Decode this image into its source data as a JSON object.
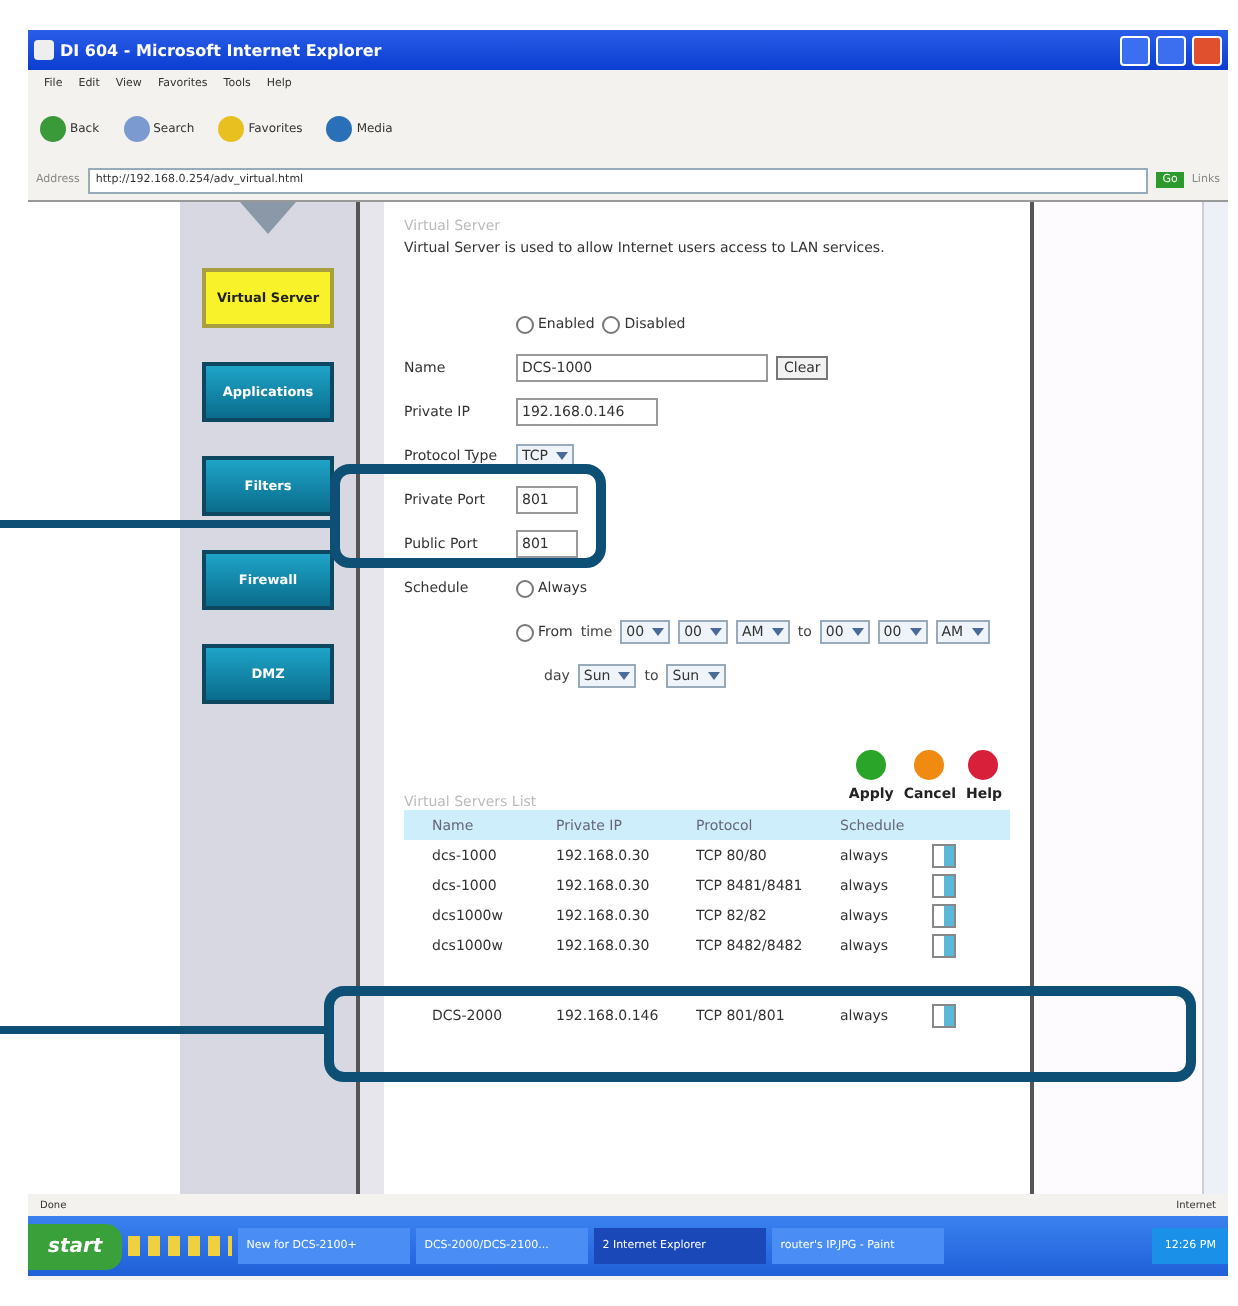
{
  "window": {
    "title": "DI 604 - Microsoft Internet Explorer"
  },
  "menu": [
    "File",
    "Edit",
    "View",
    "Favorites",
    "Tools",
    "Help"
  ],
  "toolbar": [
    {
      "kind": "back",
      "label": "Back"
    },
    {
      "kind": "search",
      "label": "Search"
    },
    {
      "kind": "favorites",
      "label": "Favorites"
    },
    {
      "kind": "media",
      "label": "Media"
    }
  ],
  "address": {
    "label": "Address",
    "value": "http://192.168.0.254/adv_virtual.html",
    "go": "Go",
    "links": "Links"
  },
  "sidebar": [
    {
      "label": "Virtual Server",
      "selected": true
    },
    {
      "label": "Applications",
      "selected": false
    },
    {
      "label": "Filters",
      "selected": false
    },
    {
      "label": "Firewall",
      "selected": false
    },
    {
      "label": "DMZ",
      "selected": false
    }
  ],
  "form": {
    "heading": "Virtual Server",
    "description": "Virtual Server is used to allow Internet users access to LAN services.",
    "status_options": [
      {
        "label": "Enabled",
        "selected": false
      },
      {
        "label": "Disabled",
        "selected": false
      }
    ],
    "name": {
      "label": "Name",
      "value": "DCS-1000",
      "clear": "Clear"
    },
    "private_ip": {
      "label": "Private IP",
      "value": "192.168.0.146"
    },
    "protocol": {
      "label": "Protocol Type",
      "value": "TCP"
    },
    "private_port": {
      "label": "Private Port",
      "value": "801"
    },
    "public_port": {
      "label": "Public Port",
      "value": "801"
    },
    "schedule": {
      "label": "Schedule",
      "always": {
        "label": "Always",
        "selected": false
      },
      "from": {
        "label": "From",
        "selected": false
      },
      "time": "time",
      "start": [
        "00",
        "00",
        "AM"
      ],
      "to": "to",
      "end": [
        "00",
        "00",
        "AM"
      ],
      "day": "day",
      "day_start": "Sun",
      "day_to": "to",
      "day_end": "Sun"
    }
  },
  "actions": [
    {
      "kind": "apply",
      "label": "Apply"
    },
    {
      "kind": "cancel",
      "label": "Cancel"
    },
    {
      "kind": "help",
      "label": "Help"
    }
  ],
  "list": {
    "heading": "Virtual Servers List",
    "columns": [
      "Name",
      "Private IP",
      "Protocol",
      "Schedule"
    ],
    "rows": [
      [
        "dcs-1000",
        "192.168.0.30",
        "TCP 80/80",
        "always"
      ],
      [
        "dcs-1000",
        "192.168.0.30",
        "TCP 8481/8481",
        "always"
      ],
      [
        "dcs1000w",
        "192.168.0.30",
        "TCP 82/82",
        "always"
      ],
      [
        "dcs1000w",
        "192.168.0.30",
        "TCP 8482/8482",
        "always"
      ],
      [
        "DCS-2000",
        "192.168.0.146",
        "TCP 801/801",
        "always"
      ]
    ]
  },
  "status_bar": {
    "left": "Done",
    "right": "Internet"
  },
  "taskbar": {
    "start": "start",
    "items": [
      {
        "label": "New for DCS-2100+",
        "selected": false
      },
      {
        "label": "DCS-2000/DCS-2100...",
        "selected": false
      },
      {
        "label": "2 Internet Explorer",
        "selected": true
      },
      {
        "label": "router's IP.JPG - Paint",
        "selected": false
      }
    ],
    "clock": "12:26 PM"
  }
}
